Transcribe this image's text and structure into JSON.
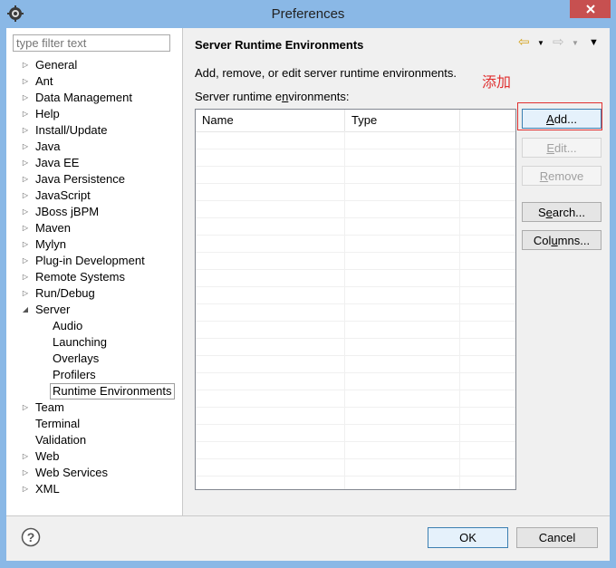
{
  "window": {
    "title": "Preferences"
  },
  "filter": {
    "placeholder": "type filter text"
  },
  "tree": [
    {
      "label": "General",
      "arrow": "▷"
    },
    {
      "label": "Ant",
      "arrow": "▷"
    },
    {
      "label": "Data Management",
      "arrow": "▷"
    },
    {
      "label": "Help",
      "arrow": "▷"
    },
    {
      "label": "Install/Update",
      "arrow": "▷"
    },
    {
      "label": "Java",
      "arrow": "▷"
    },
    {
      "label": "Java EE",
      "arrow": "▷"
    },
    {
      "label": "Java Persistence",
      "arrow": "▷"
    },
    {
      "label": "JavaScript",
      "arrow": "▷"
    },
    {
      "label": "JBoss jBPM",
      "arrow": "▷"
    },
    {
      "label": "Maven",
      "arrow": "▷"
    },
    {
      "label": "Mylyn",
      "arrow": "▷"
    },
    {
      "label": "Plug-in Development",
      "arrow": "▷"
    },
    {
      "label": "Remote Systems",
      "arrow": "▷"
    },
    {
      "label": "Run/Debug",
      "arrow": "▷"
    },
    {
      "label": "Server",
      "arrow": "◢"
    },
    {
      "label": "Audio",
      "child": true
    },
    {
      "label": "Launching",
      "child": true
    },
    {
      "label": "Overlays",
      "child": true
    },
    {
      "label": "Profilers",
      "child": true
    },
    {
      "label": "Runtime Environments",
      "child": true,
      "selected": true
    },
    {
      "label": "Team",
      "arrow": "▷"
    },
    {
      "label": "Terminal"
    },
    {
      "label": "Validation"
    },
    {
      "label": "Web",
      "arrow": "▷"
    },
    {
      "label": "Web Services",
      "arrow": "▷"
    },
    {
      "label": "XML",
      "arrow": "▷"
    }
  ],
  "page": {
    "title": "Server Runtime Environments",
    "description": "Add, remove, or edit server runtime environments.",
    "annotation": "添加",
    "list_label_pre": "Server runtime e",
    "list_label_mn": "n",
    "list_label_post": "vironments:",
    "columns": [
      "Name",
      "Type"
    ],
    "buttons": {
      "add_mn": "A",
      "add_rest": "dd...",
      "edit_mn": "E",
      "edit_rest": "dit...",
      "remove_mn": "R",
      "remove_rest": "emove",
      "search_pre": "S",
      "search_mn": "e",
      "search_rest": "arch...",
      "columns_pre": "Col",
      "columns_mn": "u",
      "columns_rest": "mns..."
    }
  },
  "footer": {
    "ok": "OK",
    "cancel": "Cancel"
  },
  "colors": {
    "accent": "#3c7fb1",
    "annotation": "#e03030",
    "titlebar": "#8ab8e6",
    "close": "#c75050"
  }
}
